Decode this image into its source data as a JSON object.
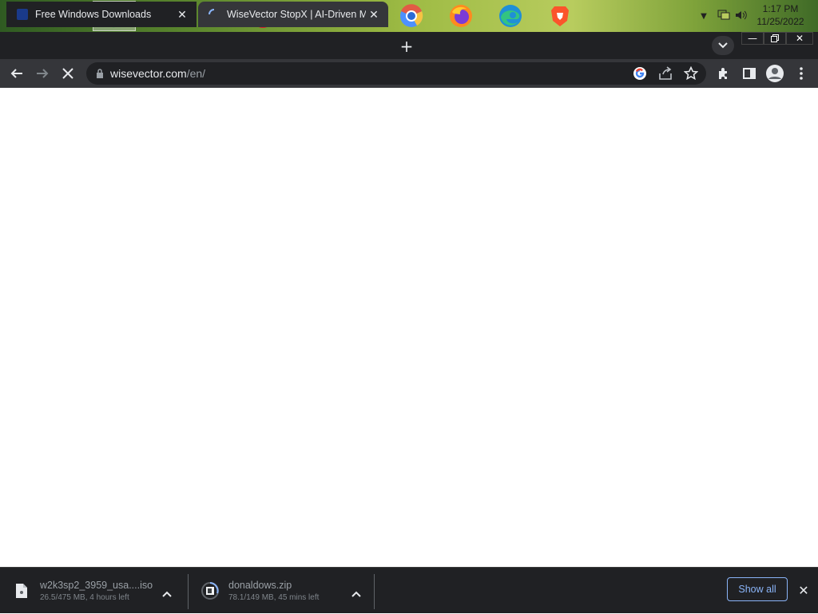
{
  "taskbar": {
    "apps": [
      {
        "name": "start-button"
      },
      {
        "name": "file-explorer"
      },
      {
        "name": "chrome",
        "active": true
      },
      {
        "name": "globe-browser"
      },
      {
        "name": "opera"
      },
      {
        "name": "opera-gx"
      },
      {
        "name": "vivaldi"
      },
      {
        "name": "chromium-yellow"
      },
      {
        "name": "chromium-blue"
      },
      {
        "name": "firefox"
      },
      {
        "name": "edge"
      },
      {
        "name": "brave"
      }
    ],
    "clock": {
      "time": "1:17 PM",
      "date": "11/25/2022"
    }
  },
  "browser": {
    "tabs": [
      {
        "title": "Free Windows Downloads",
        "active": false
      },
      {
        "title": "WiseVector StopX | AI-Driven Mal",
        "active": true
      }
    ],
    "url": {
      "host": "wisevector.com",
      "path": "/en/"
    }
  },
  "downloads": [
    {
      "filename": "w2k3sp2_3959_usa....iso",
      "status": "26.5/475 MB, 4 hours left"
    },
    {
      "filename": "donaldows.zip",
      "status": "78.1/149 MB, 45 mins left"
    }
  ],
  "shelf": {
    "show_all_label": "Show all"
  },
  "colors": {
    "tab_strip": "#202124",
    "toolbar": "#35363a",
    "accent": "#8ab4f8"
  }
}
